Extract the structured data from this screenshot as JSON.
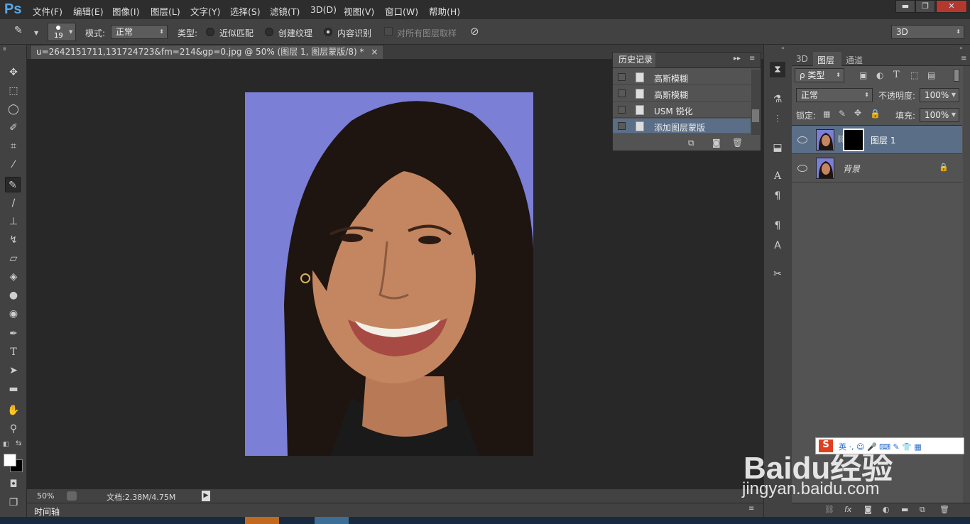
{
  "app": {
    "logo": "Ps"
  },
  "menu": [
    "文件(F)",
    "编辑(E)",
    "图像(I)",
    "图层(L)",
    "文字(Y)",
    "选择(S)",
    "滤镜(T)",
    "3D(D)",
    "视图(V)",
    "窗口(W)",
    "帮助(H)"
  ],
  "window_controls": {
    "minimize": "▬",
    "restore": "❐",
    "close": "✕"
  },
  "options": {
    "brush_size": "19",
    "mode_label": "模式:",
    "mode_value": "正常",
    "type_label": "类型:",
    "radio_proximity": "近似匹配",
    "radio_texture": "创建纹理",
    "radio_content": "内容识别",
    "sample_all_label": "对所有图层取样",
    "workspace_value": "3D"
  },
  "document": {
    "tab_title": "u=2642151711,131724723&fm=214&gp=0.jpg @ 50% (图层 1, 图层蒙版/8) *",
    "tab_close": "×",
    "zoom": "50%",
    "doc_size": "文档:2.38M/4.75M"
  },
  "timeline": {
    "label": "时间轴"
  },
  "history": {
    "title": "历史记录",
    "items": [
      "高斯模糊",
      "高斯模糊",
      "USM 锐化",
      "添加图层蒙版"
    ]
  },
  "layers_panel": {
    "tabs": [
      "3D",
      "图层",
      "通道"
    ],
    "filter_label": "ρ 类型",
    "blend_mode": "正常",
    "opacity_label": "不透明度:",
    "opacity_value": "100%",
    "lock_label": "锁定:",
    "fill_label": "填充:",
    "fill_value": "100%",
    "layers": [
      {
        "name": "图层 1"
      },
      {
        "name": "背景"
      }
    ]
  },
  "watermark": {
    "brand": "Baidu经验",
    "url": "jingyan.baidu.com"
  },
  "colors": {
    "accent": "#59a8e8",
    "photo_bg": "#7b7fd6",
    "selected_row": "#5a6e87"
  }
}
